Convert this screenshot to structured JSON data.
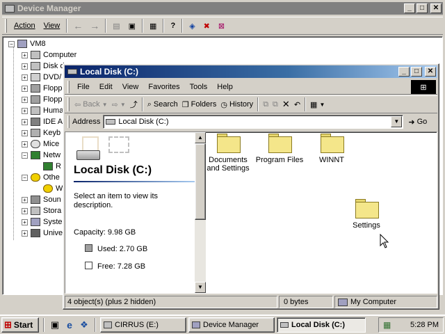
{
  "device_manager": {
    "title": "Device Manager",
    "menu": [
      "Action",
      "View"
    ],
    "tree": {
      "root": "VM8",
      "items": [
        "Computer",
        "Disk d",
        "DVD/",
        "Flopp",
        "Flopp",
        "Huma",
        "IDE A",
        "Keyb",
        "Mice",
        "Netw",
        "R",
        "Othe",
        "W",
        "Soun",
        "Stora",
        "Syste",
        "Unive"
      ]
    }
  },
  "explorer": {
    "title": "Local Disk (C:)",
    "menu": [
      "File",
      "Edit",
      "View",
      "Favorites",
      "Tools",
      "Help"
    ],
    "toolbar": {
      "back": "Back",
      "search": "Search",
      "folders": "Folders",
      "history": "History"
    },
    "address_label": "Address",
    "address_value": "Local Disk (C:)",
    "go_label": "Go",
    "panel": {
      "heading": "Local Disk (C:)",
      "hint": "Select an item to view its description.",
      "capacity": "Capacity: 9.98 GB",
      "used": "Used: 2.70 GB",
      "free": "Free: 7.28 GB"
    },
    "folders": [
      "Documents and Settings",
      "Program Files",
      "WINNT",
      "Settings"
    ],
    "status": {
      "objects": "4 object(s) (plus 2 hidden)",
      "size": "0 bytes",
      "zone": "My Computer"
    }
  },
  "taskbar": {
    "start": "Start",
    "tasks": [
      "CIRRUS (E:)",
      "Device Manager",
      "Local Disk (C:)"
    ],
    "clock": "5:28 PM"
  },
  "colors": {
    "active_title": "#0a246a",
    "face": "#d4d0c8",
    "folder": "#f4e68a"
  }
}
